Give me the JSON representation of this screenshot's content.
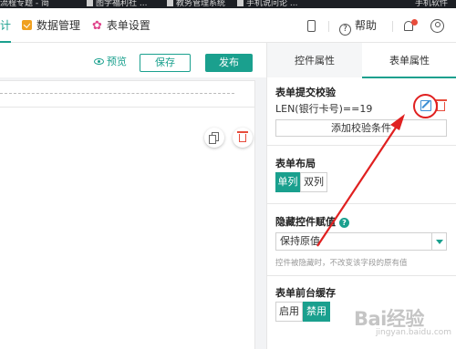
{
  "browser_tabs": [
    "流程专题 - 简",
    "图学福利社 ...",
    "教务管理系统",
    "手机说问论 ...",
    "手机软件"
  ],
  "header": {
    "nav_design": "计",
    "nav_data": "数据管理",
    "nav_form_settings": "表单设置",
    "help_label": "帮助"
  },
  "toolbar": {
    "preview_label": "预览",
    "save_label": "保存",
    "publish_label": "发布"
  },
  "panel": {
    "tab_control": "控件属性",
    "tab_form": "表单属性",
    "validation": {
      "title": "表单提交校验",
      "rule": "LEN(银行卡号)==19",
      "add_label": "添加校验条件"
    },
    "layout": {
      "title": "表单布局",
      "option_single": "单列",
      "option_double": "双列",
      "selected": "单列"
    },
    "hidden_value": {
      "title": "隐藏控件赋值",
      "selected": "保持原值",
      "hint": "控件被隐藏时，不改变该字段的原有值"
    },
    "cache": {
      "title": "表单前台缓存",
      "option_enable": "启用",
      "option_disable": "禁用",
      "selected": "禁用"
    }
  },
  "watermark": {
    "main": "Bai经验",
    "sub": "jingyan.baidu.com"
  },
  "colors": {
    "accent": "#1aa08e",
    "danger": "#e74c3c",
    "annotation": "#e02020"
  }
}
